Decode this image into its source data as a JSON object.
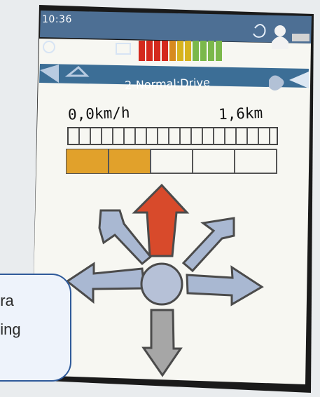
{
  "status_bar": {
    "time": "10:36"
  },
  "mode": {
    "label": "2-Normal:Drive"
  },
  "readouts": {
    "speed": "0,0km/h",
    "distance": "1,6km"
  },
  "gauges": {
    "battery_level_fraction": 0.5,
    "speed_bar_fraction": 0,
    "profile_bar_fraction": 0.4
  },
  "direction": {
    "active": "forward"
  },
  "colors": {
    "accent": "#d84a2b",
    "header": "#3b6f95",
    "progress": "#e1a12b"
  },
  "icons": [
    "light-icon",
    "battery-icon",
    "wheelchair-icon",
    "user-icon",
    "left-arrow-icon",
    "warning-icon",
    "right-arrow-icon",
    "hand-icon"
  ],
  "callout": {
    "line1": "öra",
    "line2": "ning"
  }
}
